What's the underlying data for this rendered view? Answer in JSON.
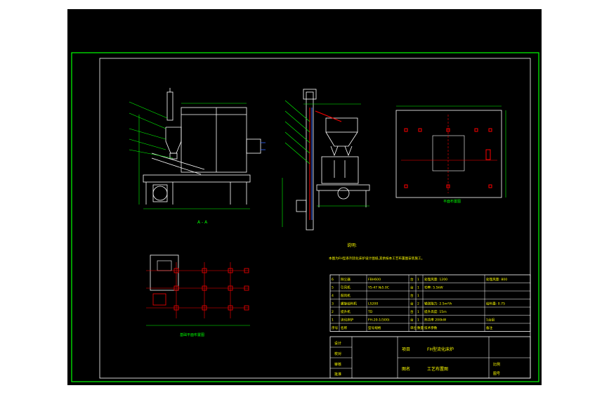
{
  "colors": {
    "background": "#000000",
    "frame": "#00ff00",
    "line": "#ffffff",
    "dimension": "#00ff00",
    "pipe": "#ff0000",
    "pipe_blue": "#3366ff",
    "label": "#ffff00",
    "hatch": "#00ffff"
  },
  "views": {
    "section_label": "A - A",
    "plan_label": "平面布置图",
    "foundation_label": "基础平面布置图"
  },
  "notes": {
    "title": "说明:",
    "text": "本图为FH型系列流化床炉设计图纸,其余按本工艺布置图安装施工。"
  },
  "parts_table": {
    "rows": [
      {
        "no": "6",
        "name": "除尘器",
        "spec": "FBH600",
        "unit": "台",
        "qty": "1",
        "param": "处理风量: 1200",
        "note": "处理风量: 800"
      },
      {
        "no": "5",
        "name": "引风机",
        "spec": "Y5-47 №5.0C",
        "unit": "台",
        "qty": "1",
        "param": "功率: 5.5kW",
        "note": ""
      },
      {
        "no": "4",
        "name": "鼓风机",
        "spec": "",
        "unit": "台",
        "qty": "1",
        "param": "",
        "note": ""
      },
      {
        "no": "3",
        "name": "螺旋给料机",
        "spec": "LS200",
        "unit": "台",
        "qty": "2",
        "param": "输送能力: 2.5m³/h",
        "note": "给料量: 0.75"
      },
      {
        "no": "2",
        "name": "提升机",
        "spec": "TD",
        "unit": "台",
        "qty": "1",
        "param": "提升高度: 15m",
        "note": ""
      },
      {
        "no": "1",
        "name": "流化床炉",
        "spec": "FH-20-1(500)",
        "unit": "台",
        "qty": "1",
        "param": "热功率 200kW",
        "note": "1台组"
      }
    ],
    "header": {
      "no": "序号",
      "name": "名称",
      "spec": "型号规格",
      "unit": "单位",
      "qty": "数量",
      "param": "技术参数",
      "note": "备注"
    }
  },
  "title_block": {
    "left_labels": [
      "设计",
      "校对",
      "审核",
      "批准"
    ],
    "project_label": "项目",
    "project_name": "FH型流化床炉",
    "drawing_label": "图名",
    "drawing_name": "工艺布置图",
    "scale_label": "比例",
    "sheet_label": "图号"
  }
}
